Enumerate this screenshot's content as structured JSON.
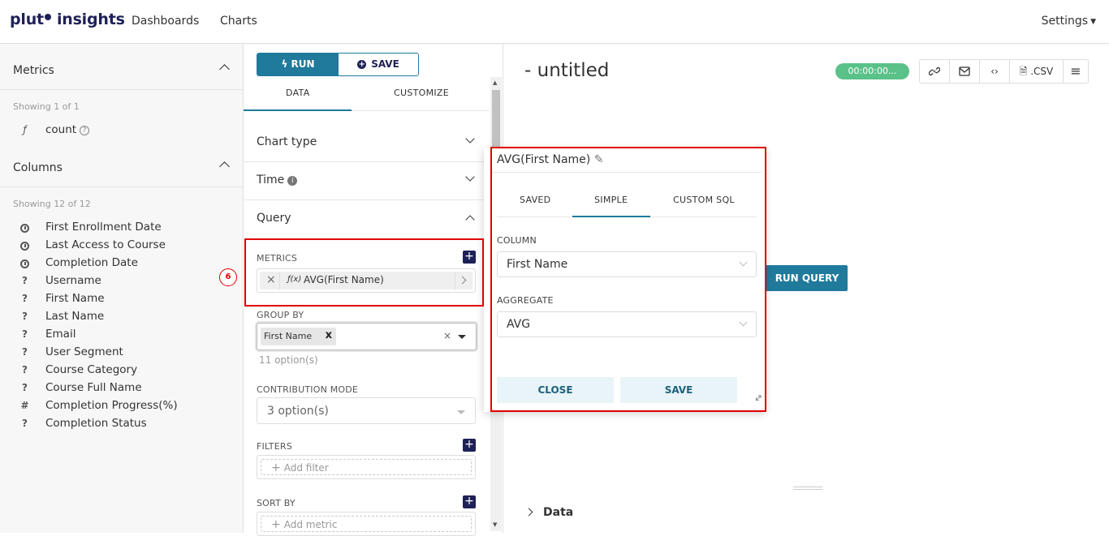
{
  "brand": {
    "name_left": "plut",
    "name_right": "insights"
  },
  "nav": {
    "dashboards": "Dashboards",
    "charts": "Charts",
    "settings": "Settings"
  },
  "datasource": {
    "metrics_title": "Metrics",
    "metrics_showing": "Showing 1 of 1",
    "metrics": [
      {
        "icon": "function-icon",
        "symbol": "ƒ",
        "label": "count"
      }
    ],
    "columns_title": "Columns",
    "columns_showing": "Showing 12 of 12",
    "columns": [
      {
        "icon": "clock-icon",
        "label": "First Enrollment Date"
      },
      {
        "icon": "clock-icon",
        "label": "Last Access to Course"
      },
      {
        "icon": "clock-icon",
        "label": "Completion Date"
      },
      {
        "icon": "question-icon",
        "symbol": "?",
        "label": "Username"
      },
      {
        "icon": "question-icon",
        "symbol": "?",
        "label": "First Name"
      },
      {
        "icon": "question-icon",
        "symbol": "?",
        "label": "Last Name"
      },
      {
        "icon": "question-icon",
        "symbol": "?",
        "label": "Email"
      },
      {
        "icon": "question-icon",
        "symbol": "?",
        "label": "User Segment"
      },
      {
        "icon": "question-icon",
        "symbol": "?",
        "label": "Course Category"
      },
      {
        "icon": "question-icon",
        "symbol": "?",
        "label": "Course Full Name"
      },
      {
        "icon": "hash-icon",
        "symbol": "#",
        "label": "Completion Progress(%)"
      },
      {
        "icon": "question-icon",
        "symbol": "?",
        "label": "Completion Status"
      }
    ]
  },
  "controls": {
    "run_label": "RUN",
    "save_label": "SAVE",
    "tab_data": "DATA",
    "tab_customize": "CUSTOMIZE",
    "chart_type": "Chart type",
    "time": "Time",
    "query": "Query",
    "metrics_label": "METRICS",
    "metric_value": "AVG(First Name)",
    "metric_fx": "ƒ(x)",
    "group_by_label": "GROUP BY",
    "group_by_chip": "First Name",
    "group_by_hint": "11 option(s)",
    "contribution_label": "CONTRIBUTION MODE",
    "contribution_value": "3 option(s)",
    "filters_label": "FILTERS",
    "add_filter": "Add filter",
    "sort_by_label": "SORT BY",
    "add_metric": "Add metric",
    "step_badge": "6"
  },
  "chart": {
    "title": "- untitled",
    "timer": "00:00:00...",
    "csv_label": ".CSV",
    "run_query": "RUN QUERY",
    "data_section": "Data"
  },
  "popover": {
    "title": "AVG(First Name)",
    "tab_saved": "SAVED",
    "tab_simple": "SIMPLE",
    "tab_custom_sql": "CUSTOM SQL",
    "column_label": "COLUMN",
    "column_value": "First Name",
    "aggregate_label": "AGGREGATE",
    "aggregate_value": "AVG",
    "close_label": "CLOSE",
    "save_label": "SAVE"
  },
  "colors": {
    "brand": "#1e2157",
    "accent": "#1f7a9c",
    "timer": "#5ac189",
    "annotation": "#e00000"
  }
}
